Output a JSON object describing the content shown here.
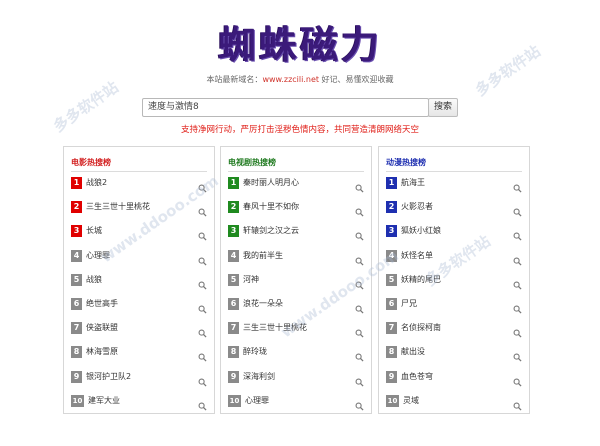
{
  "header": {
    "logo_text": "蜘蛛磁力",
    "domain_prefix": "本站最新域名：",
    "domain_url": "www.zzcili.net",
    "domain_suffix": " 好记、易懂欢迎收藏"
  },
  "search": {
    "value": "速度与激情8",
    "button_label": "搜索"
  },
  "notice": "支持净网行动，严厉打击淫秽色情内容，共同营造清朗网络天空",
  "colors": {
    "top1_movie": "#e00000",
    "top1_tv": "#1f8a1f",
    "top1_anime": "#1e2fb0",
    "default_badge": "#8a8a8a",
    "movie_title": "#d21f1f",
    "tv_title": "#1f7a1f",
    "anime_title": "#1e2fb0"
  },
  "panels": [
    {
      "title": "电影热搜榜",
      "items": [
        {
          "n": "1",
          "t": "战狼2"
        },
        {
          "n": "2",
          "t": "三生三世十里桃花"
        },
        {
          "n": "3",
          "t": "长城"
        },
        {
          "n": "4",
          "t": "心理罪"
        },
        {
          "n": "5",
          "t": "战狼"
        },
        {
          "n": "6",
          "t": "绝世高手"
        },
        {
          "n": "7",
          "t": "侠盗联盟"
        },
        {
          "n": "8",
          "t": "林海雪原"
        },
        {
          "n": "9",
          "t": "银河护卫队2"
        },
        {
          "n": "10",
          "t": "建军大业"
        }
      ]
    },
    {
      "title": "电视剧热搜榜",
      "items": [
        {
          "n": "1",
          "t": "秦时丽人明月心"
        },
        {
          "n": "2",
          "t": "春风十里不如你"
        },
        {
          "n": "3",
          "t": "轩辕剑之汉之云"
        },
        {
          "n": "4",
          "t": "我的前半生"
        },
        {
          "n": "5",
          "t": "河神"
        },
        {
          "n": "6",
          "t": "浪花一朵朵"
        },
        {
          "n": "7",
          "t": "三生三世十里桃花"
        },
        {
          "n": "8",
          "t": "醉玲珑"
        },
        {
          "n": "9",
          "t": "深海利剑"
        },
        {
          "n": "10",
          "t": "心理罪"
        }
      ]
    },
    {
      "title": "动漫热搜榜",
      "items": [
        {
          "n": "1",
          "t": "航海王"
        },
        {
          "n": "2",
          "t": "火影忍者"
        },
        {
          "n": "3",
          "t": "狐妖小红娘"
        },
        {
          "n": "4",
          "t": "妖怪名单"
        },
        {
          "n": "5",
          "t": "妖精的尾巴"
        },
        {
          "n": "6",
          "t": "尸兄"
        },
        {
          "n": "7",
          "t": "名侦探柯南"
        },
        {
          "n": "8",
          "t": "献出没"
        },
        {
          "n": "9",
          "t": "血色苍穹"
        },
        {
          "n": "10",
          "t": "灵域"
        }
      ]
    }
  ],
  "watermark": "多多软件站 www.ddooo.com",
  "icons": {
    "row_search": "search-icon"
  }
}
